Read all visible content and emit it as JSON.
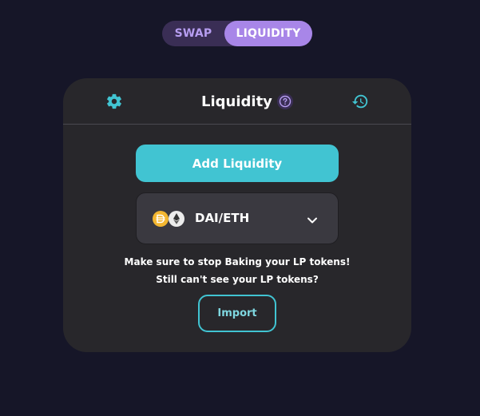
{
  "toggle": {
    "swap_label": "SWAP",
    "liquidity_label": "LIQUIDITY",
    "active": "liquidity"
  },
  "card": {
    "title": "Liquidity",
    "help_icon": "question-icon",
    "settings_icon": "gear-icon",
    "history_icon": "history-icon",
    "add_button_label": "Add Liquidity",
    "pair": {
      "label": "DAI/ETH",
      "token_icons": [
        "dai-icon",
        "eth-icon"
      ]
    },
    "note_line1": "Make sure to stop Baking your LP tokens!",
    "note_line2": "Still can't see your LP tokens?",
    "import_button_label": "Import"
  },
  "colors": {
    "background": "#161628",
    "card": "#28272b",
    "accent_cyan": "#41c4d2",
    "accent_purple": "#a886e8",
    "toggle_bg": "#3a2e55",
    "select_bg": "#3a3940"
  }
}
